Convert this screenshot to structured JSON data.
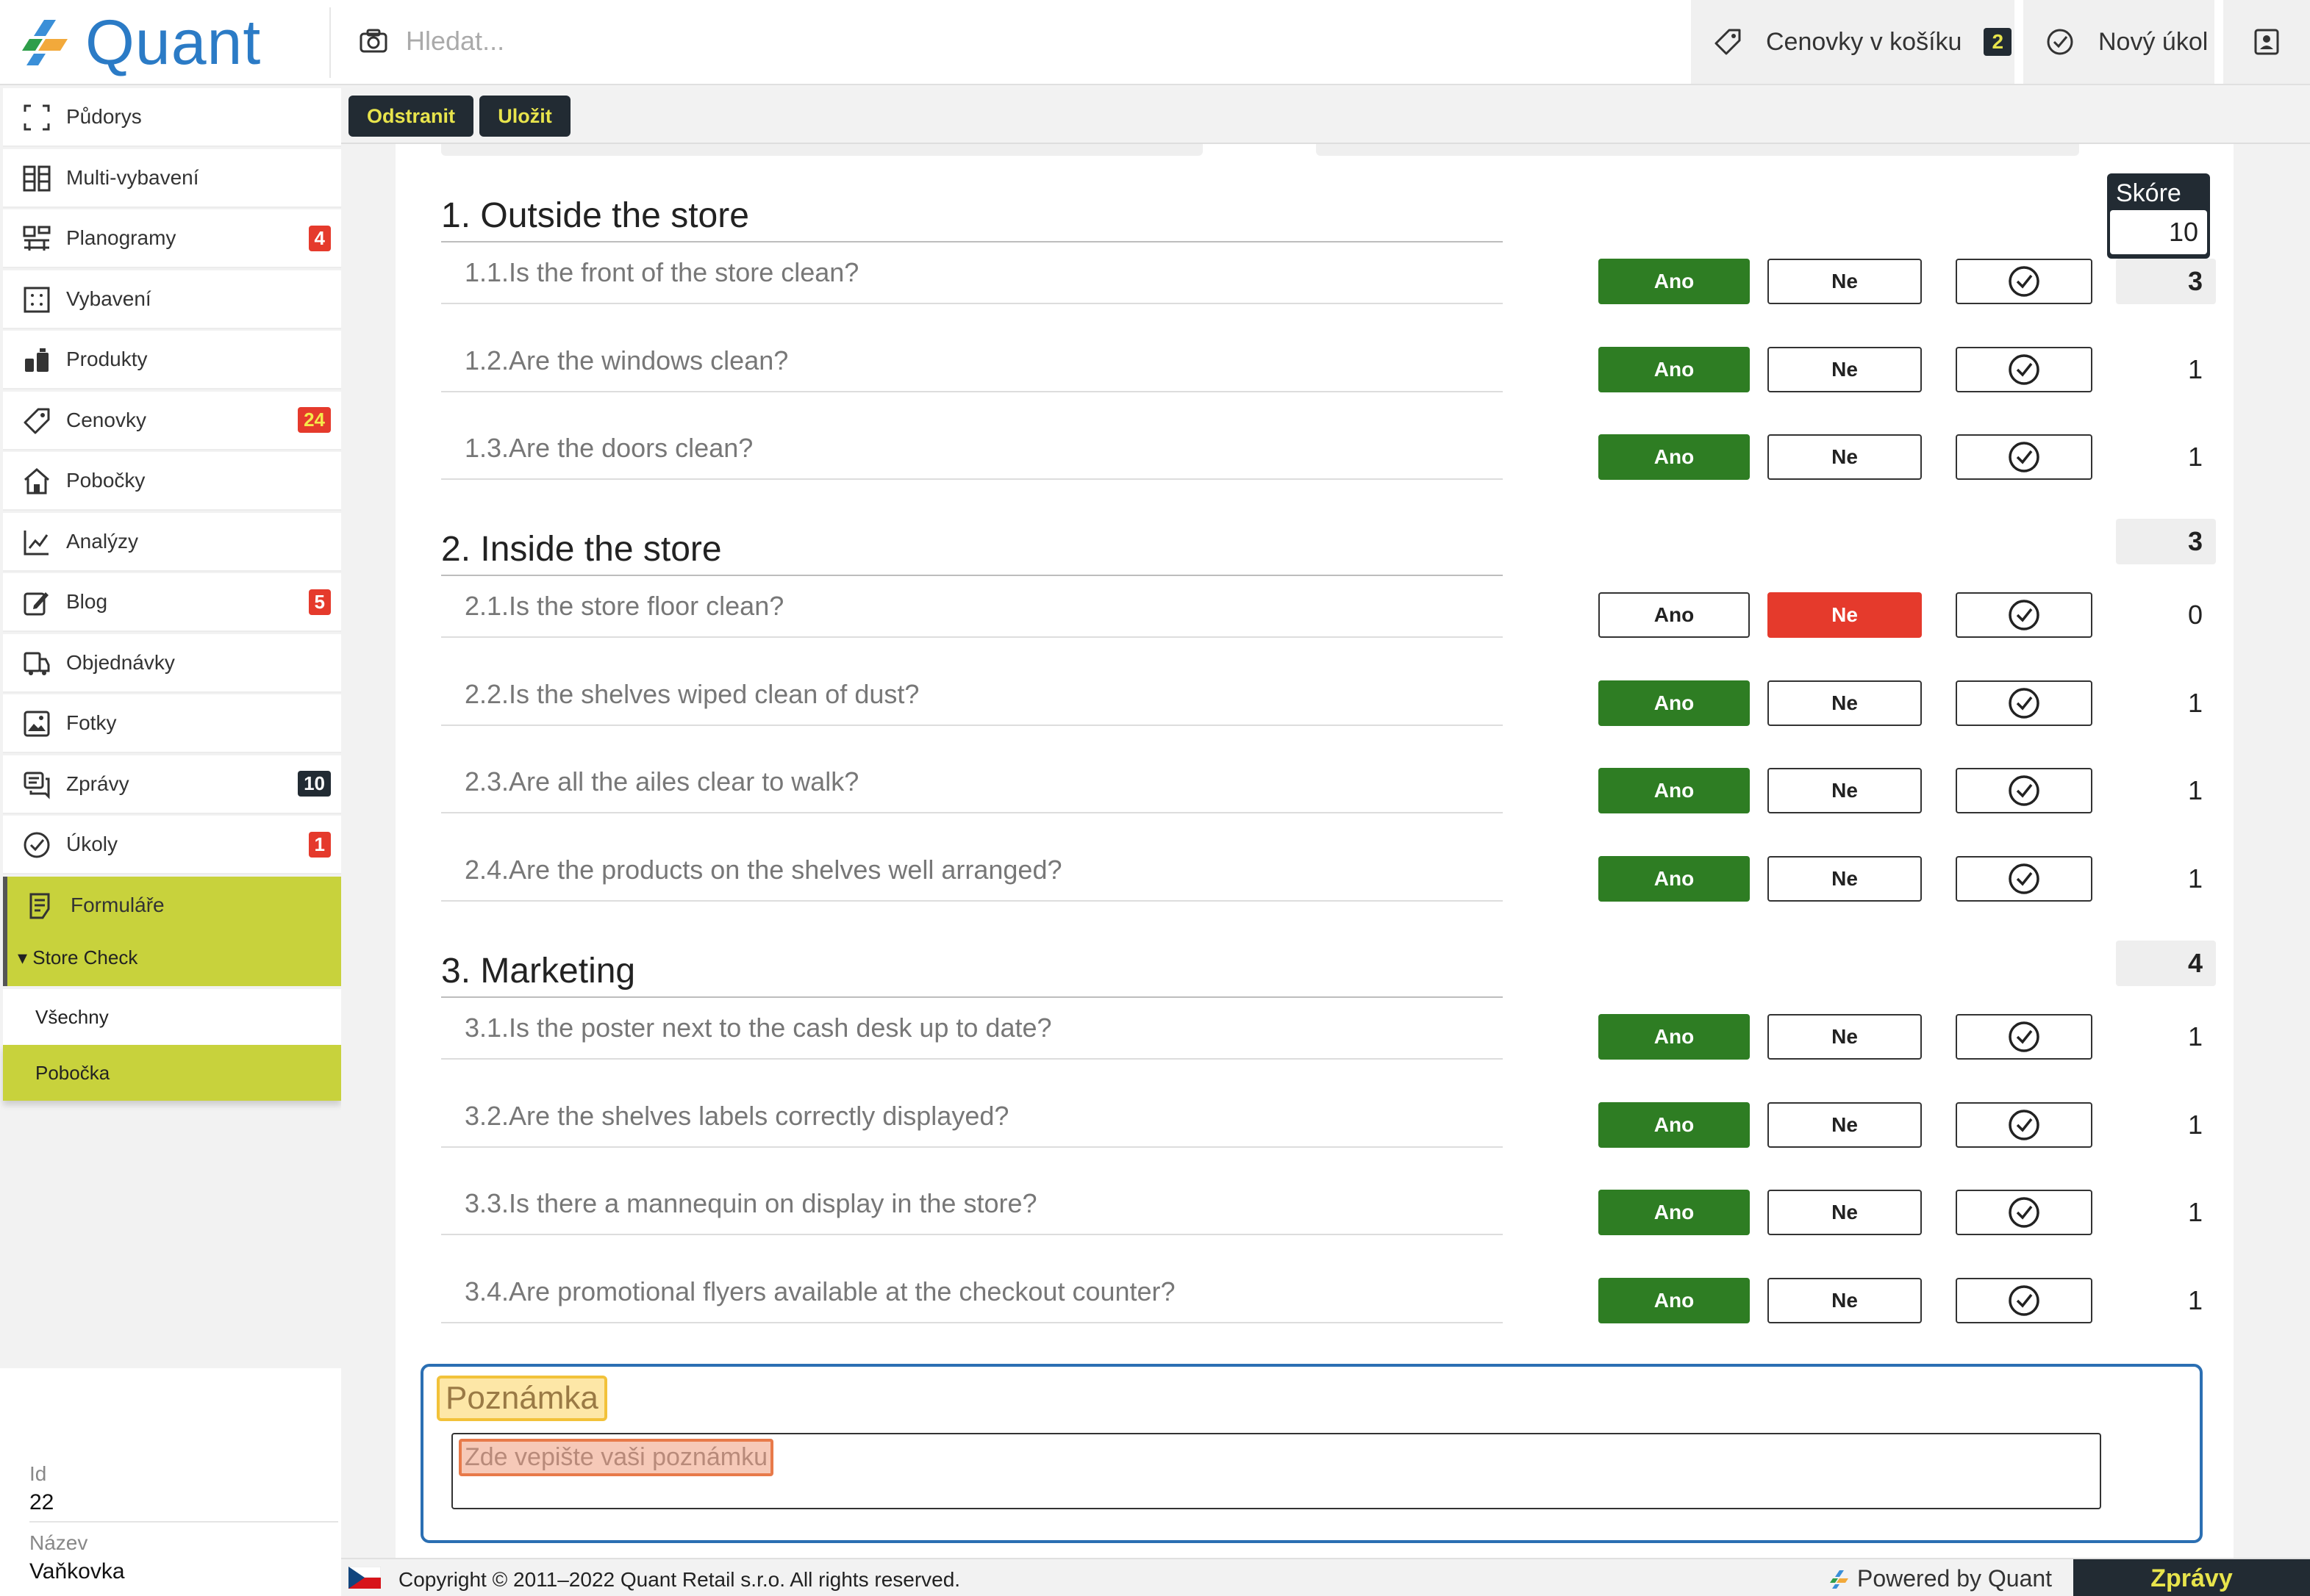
{
  "app": {
    "logo_text": "Quant",
    "search_placeholder": "Hledat...",
    "cart_label": "Cenovky v košíku",
    "cart_count": "2",
    "task_label": "Nový úkol"
  },
  "sidebar": {
    "items": [
      {
        "label": "Půdorys",
        "icon": "floorplan-icon",
        "count": ""
      },
      {
        "label": "Multi-vybavení",
        "icon": "multi-equipment-icon",
        "count": ""
      },
      {
        "label": "Planogramy",
        "icon": "planogram-icon",
        "count": "4"
      },
      {
        "label": "Vybavení",
        "icon": "equipment-icon",
        "count": ""
      },
      {
        "label": "Produkty",
        "icon": "products-icon",
        "count": ""
      },
      {
        "label": "Cenovky",
        "icon": "price-tag-icon",
        "count": "24"
      },
      {
        "label": "Pobočky",
        "icon": "store-icon",
        "count": ""
      },
      {
        "label": "Analýzy",
        "icon": "analytics-icon",
        "count": ""
      },
      {
        "label": "Blog",
        "icon": "blog-icon",
        "count": "5"
      },
      {
        "label": "Objednávky",
        "icon": "orders-icon",
        "count": ""
      },
      {
        "label": "Fotky",
        "icon": "photos-icon",
        "count": ""
      },
      {
        "label": "Zprávy",
        "icon": "messages-icon",
        "count": "10"
      },
      {
        "label": "Úkoly",
        "icon": "tasks-icon",
        "count": "1"
      },
      {
        "label": "Formuláře",
        "icon": "forms-icon",
        "count": ""
      }
    ],
    "submenu_head": "▾ Store Check",
    "submenu_items": [
      "Všechny",
      "Pobočka"
    ],
    "meta": {
      "id_label": "Id",
      "id_value": "22",
      "name_label": "Název",
      "name_value": "Vaňkovka"
    }
  },
  "actions": {
    "delete_label": "Odstranit",
    "save_label": "Uložit"
  },
  "form": {
    "score_header": "Skóre",
    "score_total": "10",
    "yes_label": "Ano",
    "no_label": "Ne",
    "sections": [
      {
        "title": "1. Outside the store",
        "score": "3",
        "questions": [
          {
            "text": "1.1.Is the front of the store clean?",
            "answer": "Ano",
            "score": "3"
          },
          {
            "text": "1.2.Are the windows clean?",
            "answer": "Ano",
            "score": "1"
          },
          {
            "text": "1.3.Are the doors clean?",
            "answer": "Ano",
            "score": "1"
          }
        ]
      },
      {
        "title": "2. Inside the store",
        "score": "3",
        "questions": [
          {
            "text": "2.1.Is the store floor clean?",
            "answer": "Ne",
            "score": "0"
          },
          {
            "text": "2.2.Is the shelves wiped clean of dust?",
            "answer": "Ano",
            "score": "1"
          },
          {
            "text": "2.3.Are all the ailes clear to walk?",
            "answer": "Ano",
            "score": "1"
          },
          {
            "text": "2.4.Are the products on the shelves well arranged?",
            "answer": "Ano",
            "score": "1"
          }
        ]
      },
      {
        "title": "3. Marketing",
        "score": "4",
        "questions": [
          {
            "text": "3.1.Is the poster next to the cash desk up to date?",
            "answer": "Ano",
            "score": "1"
          },
          {
            "text": "3.2.Are the shelves labels correctly displayed?",
            "answer": "Ano",
            "score": "1"
          },
          {
            "text": "3.3.Is there a mannequin on display in the store?",
            "answer": "Ano",
            "score": "1"
          },
          {
            "text": "3.4.Are promotional flyers available at the checkout counter?",
            "answer": "Ano",
            "score": "1"
          }
        ]
      }
    ],
    "note_title": "Poznámka",
    "note_placeholder": "Zde vepište vaši poznámku"
  },
  "footer": {
    "copyright": "Copyright © 2011–2022 Quant Retail s.r.o. All rights reserved.",
    "powered": "Powered by Quant",
    "messages_button": "Zprávy"
  },
  "colors": {
    "brand_blue": "#2b7bc6",
    "accent_lime": "#c8d23c",
    "dark": "#222b33",
    "yes_green": "#2e7d23",
    "no_red": "#e53a2c",
    "badge_yellow": "#e8e44c"
  }
}
